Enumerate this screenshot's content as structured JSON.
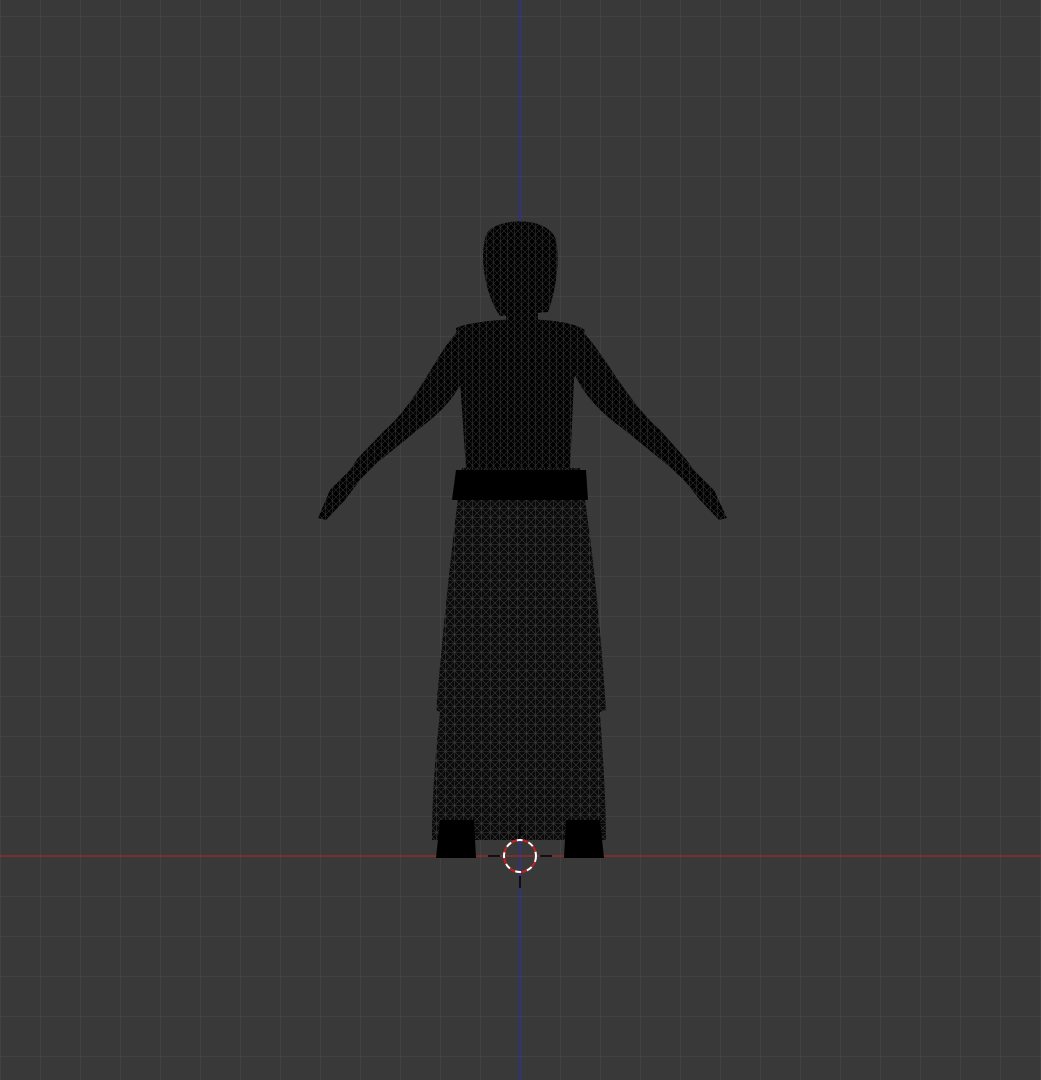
{
  "viewport": {
    "background_color": "#393939",
    "grid_color": "#434343",
    "x_axis_color": "#8a2a2a",
    "z_axis_color": "#2a2fa0",
    "cursor_colors": [
      "#ffffff",
      "#c81e1e"
    ]
  },
  "scene": {
    "object_icon": "wireframe-mesh-character",
    "object_color": "#000000",
    "cursor_icon": "3d-cursor-icon"
  }
}
